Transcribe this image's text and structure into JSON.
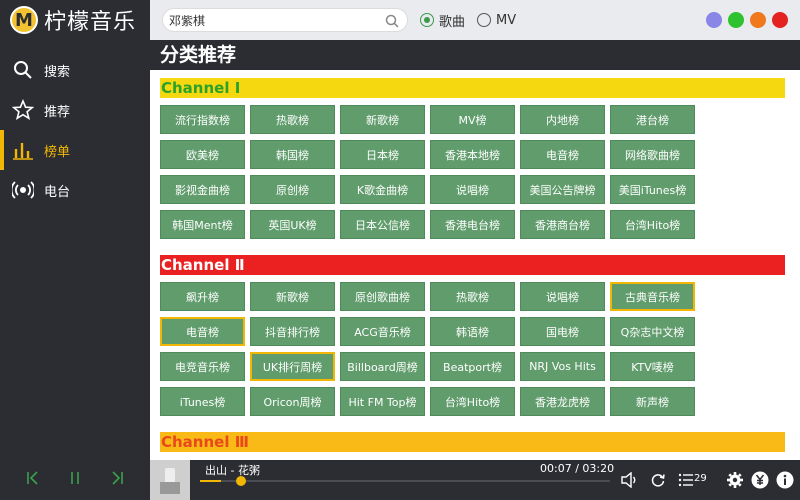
{
  "app": {
    "logo_letter": "M",
    "title": "柠檬音乐"
  },
  "search": {
    "value": "邓紫棋",
    "placeholder": ""
  },
  "mode": {
    "song_label": "歌曲",
    "mv_label": "MV",
    "selected": "歌曲"
  },
  "window_controls": [
    "#8a86e8",
    "#2ec22e",
    "#f0791e",
    "#e52222"
  ],
  "sidebar": {
    "items": [
      {
        "label": "搜索",
        "icon": "search-icon",
        "active": false
      },
      {
        "label": "推荐",
        "icon": "star-icon",
        "active": false
      },
      {
        "label": "榜单",
        "icon": "chart-bars-icon",
        "active": true
      },
      {
        "label": "电台",
        "icon": "radio-icon",
        "active": false
      }
    ]
  },
  "page_title": "分类推荐",
  "channels": [
    {
      "name": "Channel Ⅰ",
      "bg": "#f5d80f",
      "color": "#2ba32b",
      "items": [
        {
          "label": "流行指数榜"
        },
        {
          "label": "热歌榜"
        },
        {
          "label": "新歌榜"
        },
        {
          "label": "MV榜"
        },
        {
          "label": "内地榜"
        },
        {
          "label": "港台榜"
        },
        {
          "label": "欧美榜"
        },
        {
          "label": "韩国榜"
        },
        {
          "label": "日本榜"
        },
        {
          "label": "香港本地榜"
        },
        {
          "label": "电音榜"
        },
        {
          "label": "网络歌曲榜"
        },
        {
          "label": "影视金曲榜"
        },
        {
          "label": "原创榜"
        },
        {
          "label": "K歌金曲榜"
        },
        {
          "label": "说唱榜"
        },
        {
          "label": "美国公告牌榜"
        },
        {
          "label": "美国iTunes榜"
        },
        {
          "label": "韩国Ment榜"
        },
        {
          "label": "英国UK榜"
        },
        {
          "label": "日本公信榜"
        },
        {
          "label": "香港电台榜"
        },
        {
          "label": "香港商台榜"
        },
        {
          "label": "台湾Hito榜"
        }
      ]
    },
    {
      "name": "Channel Ⅱ",
      "bg": "#eb2020",
      "color": "#ffffff",
      "items": [
        {
          "label": "飙升榜"
        },
        {
          "label": "新歌榜"
        },
        {
          "label": "原创歌曲榜"
        },
        {
          "label": "热歌榜"
        },
        {
          "label": "说唱榜"
        },
        {
          "label": "古典音乐榜",
          "highlight": true
        },
        {
          "label": "电音榜",
          "highlight": true
        },
        {
          "label": "抖音排行榜"
        },
        {
          "label": "ACG音乐榜"
        },
        {
          "label": "韩语榜"
        },
        {
          "label": "国电榜"
        },
        {
          "label": "Q杂志中文榜"
        },
        {
          "label": "电竞音乐榜"
        },
        {
          "label": "UK排行周榜",
          "highlight": true
        },
        {
          "label": "Billboard周榜"
        },
        {
          "label": "Beatport榜"
        },
        {
          "label": "NRJ Vos Hits"
        },
        {
          "label": "KTV唛榜"
        },
        {
          "label": "iTunes榜"
        },
        {
          "label": "Oricon周榜"
        },
        {
          "label": "Hit FM Top榜"
        },
        {
          "label": "台湾Hito榜"
        },
        {
          "label": "香港龙虎榜"
        },
        {
          "label": "新声榜"
        }
      ]
    },
    {
      "name": "Channel Ⅲ",
      "bg": "#f9b916",
      "color": "#e8491c",
      "items": []
    }
  ],
  "player": {
    "song": "出山 - 花粥",
    "time": "00:07 / 03:20",
    "progress": 0.05,
    "playlist_count": "29",
    "accent": "#f2b705"
  }
}
